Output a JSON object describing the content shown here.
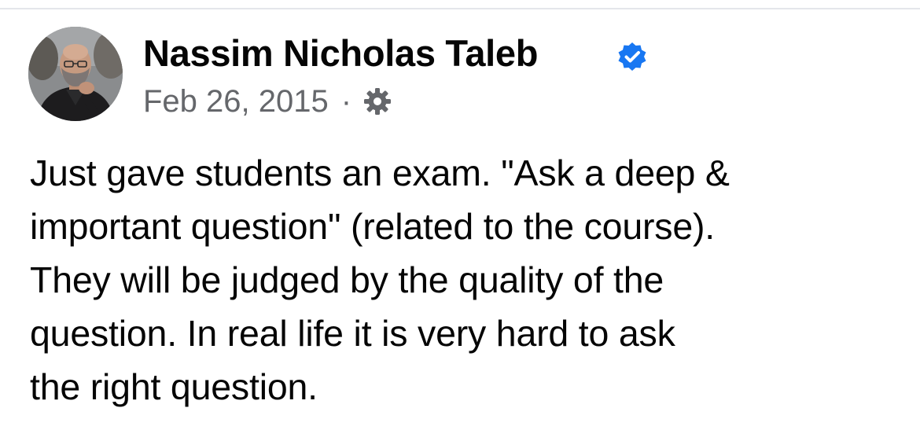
{
  "post": {
    "author": "Nassim Nicholas Taleb",
    "verified_icon": "verified-badge-icon",
    "date": "Feb 26, 2015",
    "separator": "·",
    "audience_icon": "gear-icon",
    "text": "Just gave students an exam. \"Ask a deep &\nimportant question\" (related to the course).\nThey will be judged by the quality of the\nquestion. In real life it is very hard to ask\nthe right question."
  },
  "colors": {
    "verified": "#1877f2",
    "meta_text": "#65676b",
    "body_text": "#050505"
  }
}
